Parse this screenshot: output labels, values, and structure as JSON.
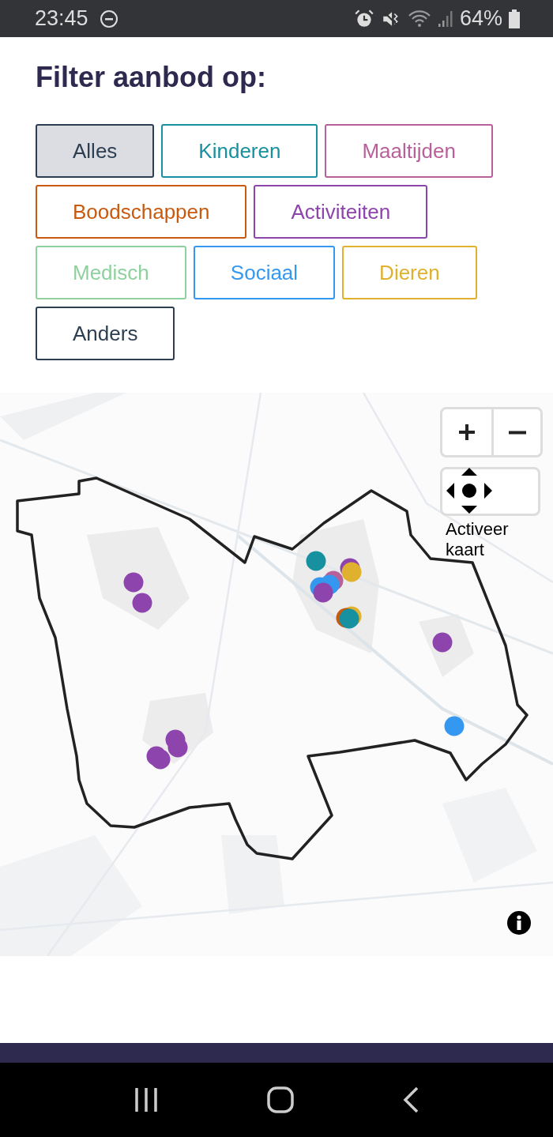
{
  "status_bar": {
    "time": "23:45",
    "battery": "64%"
  },
  "heading": "Filter aanbod op:",
  "filters": [
    {
      "label": "Alles",
      "color": "#2c3e50",
      "selected": true
    },
    {
      "label": "Kinderen",
      "color": "#17909f",
      "selected": false
    },
    {
      "label": "Maaltijden",
      "color": "#b8609a",
      "selected": false
    },
    {
      "label": "Boodschappen",
      "color": "#c9590f",
      "selected": false
    },
    {
      "label": "Activiteiten",
      "color": "#8e44ad",
      "selected": false
    },
    {
      "label": "Medisch",
      "color": "#8fd19e",
      "selected": false
    },
    {
      "label": "Sociaal",
      "color": "#3498f0",
      "selected": false
    },
    {
      "label": "Dieren",
      "color": "#e0b12e",
      "selected": false
    },
    {
      "label": "Anders",
      "color": "#2c3e50",
      "selected": false
    }
  ],
  "map": {
    "activate_label": "Activeer kaart",
    "markers": [
      {
        "color": "#8e44ad"
      },
      {
        "color": "#8e44ad"
      },
      {
        "color": "#8e44ad"
      },
      {
        "color": "#8e44ad"
      },
      {
        "color": "#8e44ad"
      },
      {
        "color": "#8e44ad"
      },
      {
        "color": "#8e44ad"
      },
      {
        "color": "#3498f0"
      },
      {
        "color": "#17909f"
      },
      {
        "color": "#8e44ad"
      },
      {
        "color": "#e0b12e"
      },
      {
        "color": "#b8609a"
      },
      {
        "color": "#3498f0"
      },
      {
        "color": "#3498f0"
      },
      {
        "color": "#8e44ad"
      },
      {
        "color": "#e0b12e"
      },
      {
        "color": "#c9590f"
      },
      {
        "color": "#17909f"
      }
    ]
  }
}
